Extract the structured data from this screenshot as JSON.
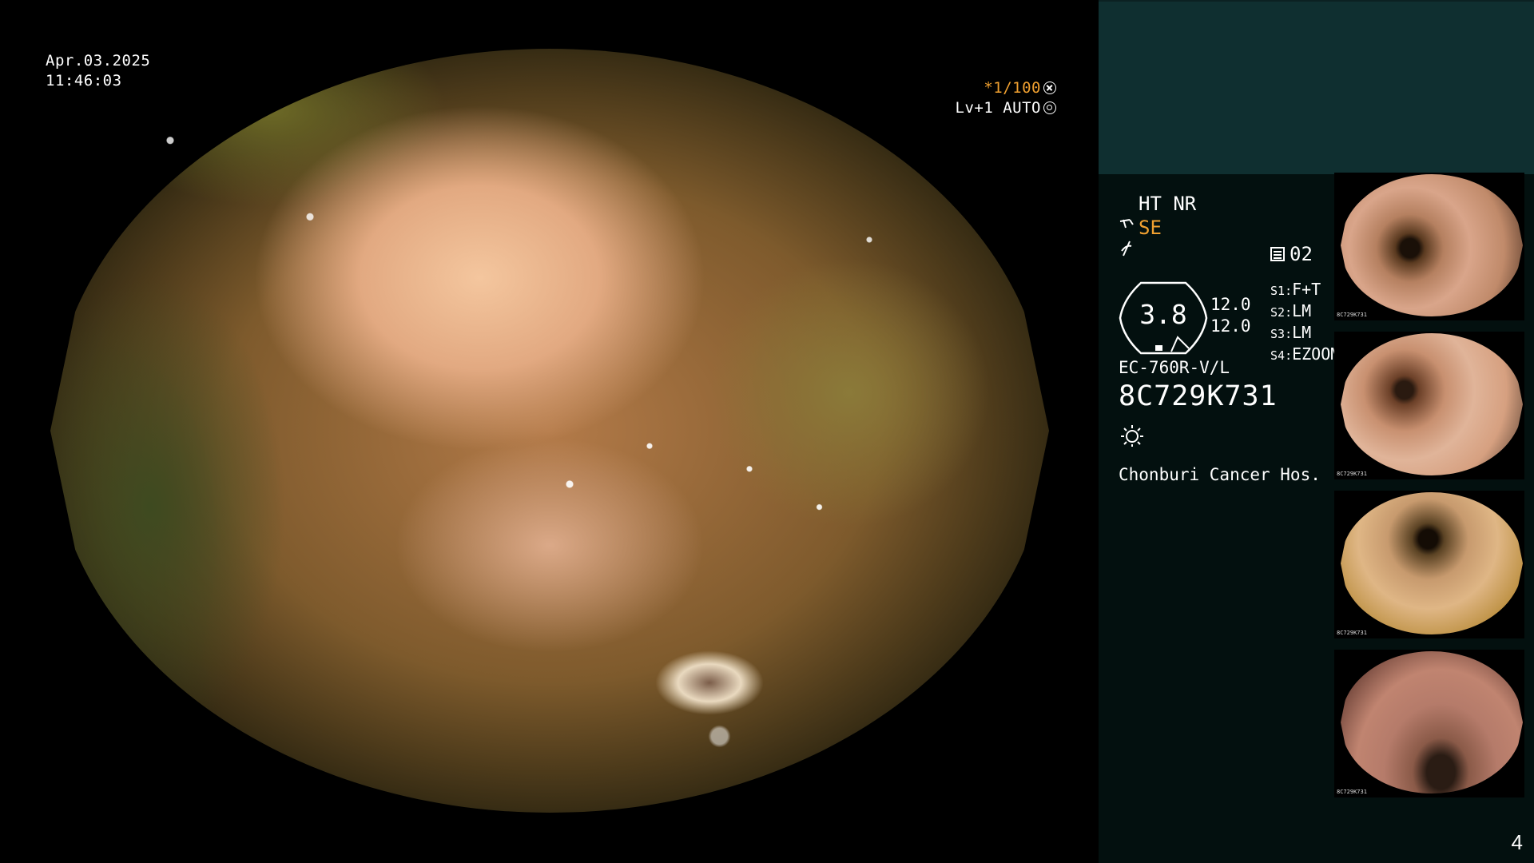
{
  "overlay": {
    "date": "Apr.03.2025",
    "time": "11:46:03",
    "shutter": "*1/100",
    "level": "Lv+1 AUTO"
  },
  "panel": {
    "mode": "HT NR",
    "se": "SE",
    "memo_count": "02",
    "gauge_value": "3.8",
    "gauge_side_1": "12.0",
    "gauge_side_2": "12.0",
    "settings": [
      {
        "key": "S1",
        "value": "F+T"
      },
      {
        "key": "S2",
        "value": "LM"
      },
      {
        "key": "S3",
        "value": "LM"
      },
      {
        "key": "S4",
        "value": "EZOOM"
      }
    ],
    "scope_model": "EC-760R-V/L",
    "serial": "8C729K731",
    "hospital": "Chonburi Cancer Hos.",
    "thumb_caption": "8C729K731"
  },
  "page_number": "4",
  "icons": [
    "star-aperture-icon",
    "auto-ring-icon",
    "scope-icon",
    "function-icon",
    "memo-icon",
    "brightness-icon"
  ],
  "colors": {
    "accent_orange": "#f0a030",
    "panel_top": "#0f2f30",
    "panel_bg": "#03100f"
  }
}
